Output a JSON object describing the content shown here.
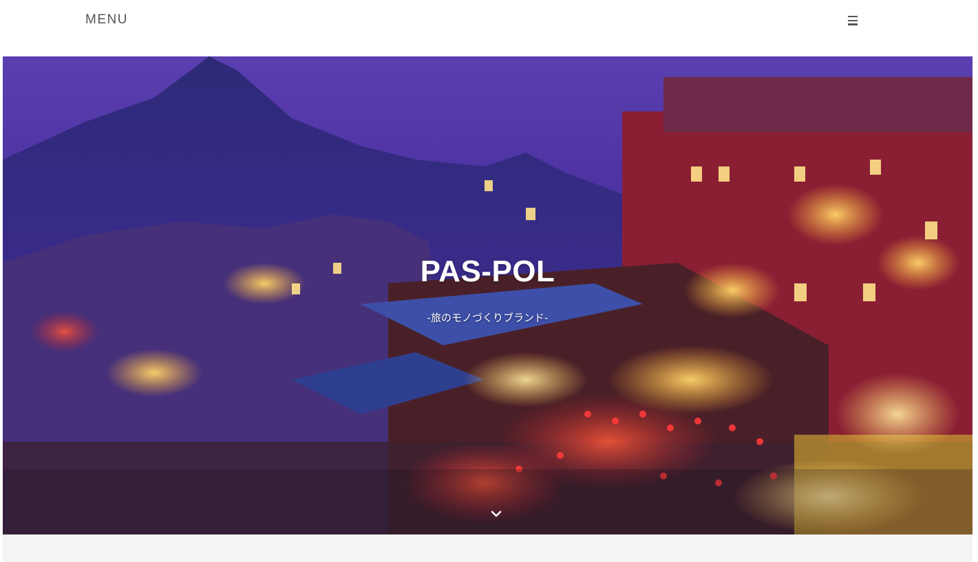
{
  "header": {
    "menu_label": "MENU",
    "menu_icon": "hamburger-menu-icon"
  },
  "hero": {
    "title": "PAS-POL",
    "subtitle": "-旅のモノづくりブランド-",
    "scroll_icon": "chevron-down-icon",
    "image": "night-hillside-town-photo"
  },
  "colors": {
    "menu_text": "#555555",
    "hero_text": "#ffffff",
    "below_background": "#f4f4f4"
  }
}
